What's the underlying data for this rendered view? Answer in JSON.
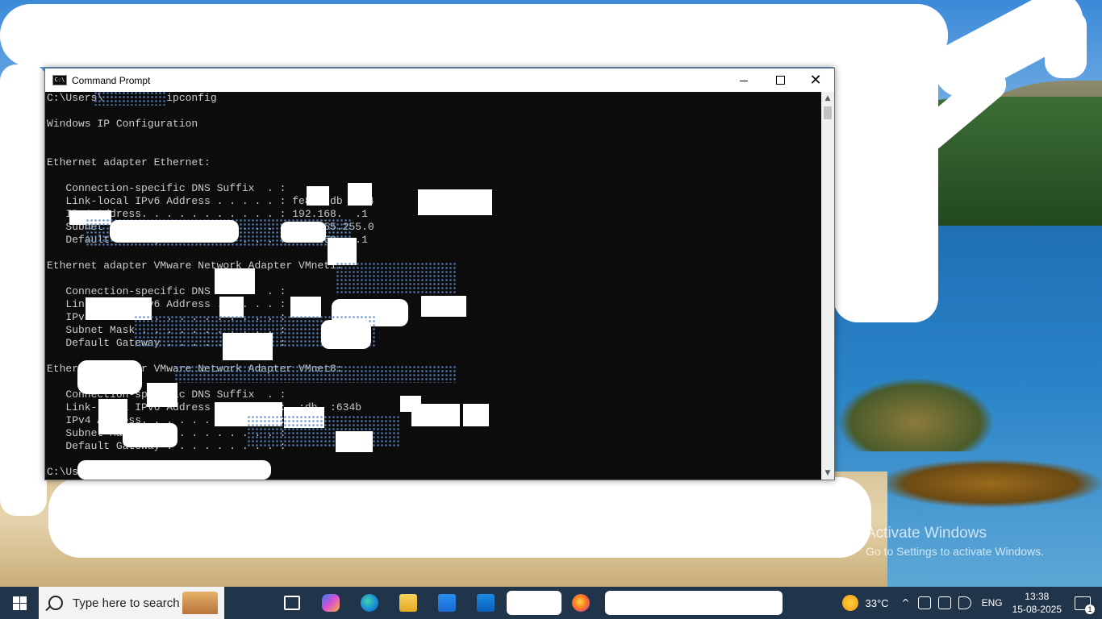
{
  "window": {
    "title": "Command Prompt",
    "controls": {
      "minimize": "minimize",
      "maximize": "maximize",
      "close": "✕"
    }
  },
  "console": {
    "lines": [
      "C:\\Users\\          ipconfig",
      "",
      "Windows IP Configuration",
      "",
      "",
      "Ethernet adapter Ethernet:",
      "",
      "   Connection-specific DNS Suffix  . :",
      "   Link-local IPv6 Address . . . . . : fe80::db  234",
      "   IPv4 Address. . . . . . . . . . . : 192.168.  .1",
      "   Subnet Mask . . . . . . . . . . . : 255.255.255.0",
      "   Default Gateway . . . . . . . . . : 192.168.  .1",
      "",
      "Ethernet adapter VMware Network Adapter VMnet1:",
      "",
      "   Connection-specific DNS Suffix  . :",
      "   Link-local IPv6 Address . . . . . :",
      "   IPv4 Address. . . . . . . . . . . :",
      "   Subnet Mask . . . . . . . . . . . :",
      "   Default Gateway . . . . . . . . . :",
      "",
      "Ethernet adapter VMware Network Adapter VMnet8:",
      "",
      "   Connection-specific DNS Suffix  . :",
      "   Link-local IPv6 Address . . . . . :  :db  :634b",
      "   IPv4 Address. . . . . . . . . . . :   .16",
      "   Subnet Mask . . . . . . . . . . . :",
      "   Default Gateway . . . . . . . . . :",
      "",
      "C:\\Users"
    ]
  },
  "watermark": {
    "title": "Activate Windows",
    "subtitle": "Go to Settings to activate Windows."
  },
  "taskbar": {
    "search_placeholder": "Type here to search",
    "apps": [
      "task-view",
      "copilot",
      "edge",
      "file-explorer",
      "microsoft-store",
      "outlook",
      "firefox"
    ],
    "weather": "33°C",
    "language": "ENG",
    "time": "13:38",
    "date": "15-08-2025",
    "notifications_count": "1"
  },
  "colors": {
    "console_bg": "#0c0c0c",
    "console_fg": "#cccccc",
    "taskbar_bg": "#20344a"
  }
}
